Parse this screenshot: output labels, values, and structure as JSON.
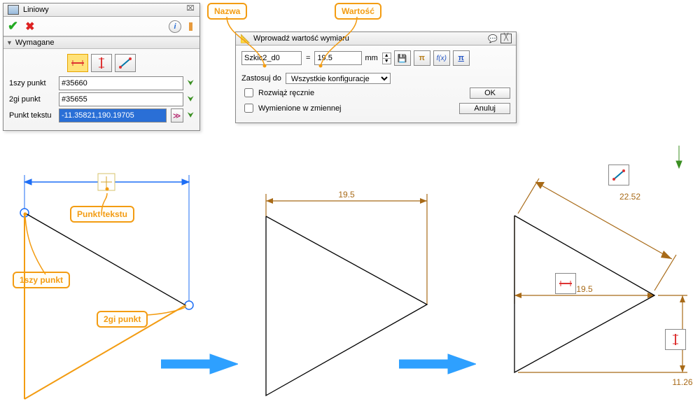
{
  "liniowy": {
    "title": "Liniowy",
    "section": "Wymagane",
    "p1_label": "1szy punkt",
    "p1_value": "#35660",
    "p2_label": "2gi punkt",
    "p2_value": "#35655",
    "pt_label": "Punkt tekstu",
    "pt_value": "-11.35821,190.19705"
  },
  "wprowadz": {
    "title": "Wprowadź wartość wymiaru",
    "name_value": "Szkic2_d0",
    "eq_value": "19.5",
    "unit": "mm",
    "apply_label": "Zastosuj do",
    "apply_value": "Wszystkie konfiguracje",
    "chk1": "Rozwiąż ręcznie",
    "chk2": "Wymienione w zmiennej",
    "ok": "OK",
    "cancel": "Anuluj"
  },
  "callouts": {
    "nazwa": "Nazwa",
    "wartosc": "Wartość",
    "tekst": "Punkt tekstu",
    "p1": "1szy punkt",
    "p2": "2gi punkt"
  },
  "dims": {
    "d1": "19.5",
    "d2": "19.5",
    "d3": "22.52",
    "d4": "11.26"
  },
  "icons": {
    "expand": "≫",
    "save": "💾",
    "pi": "π",
    "fx": "f(x)",
    "pi2": "π",
    "info": "i",
    "talk": "💬"
  }
}
